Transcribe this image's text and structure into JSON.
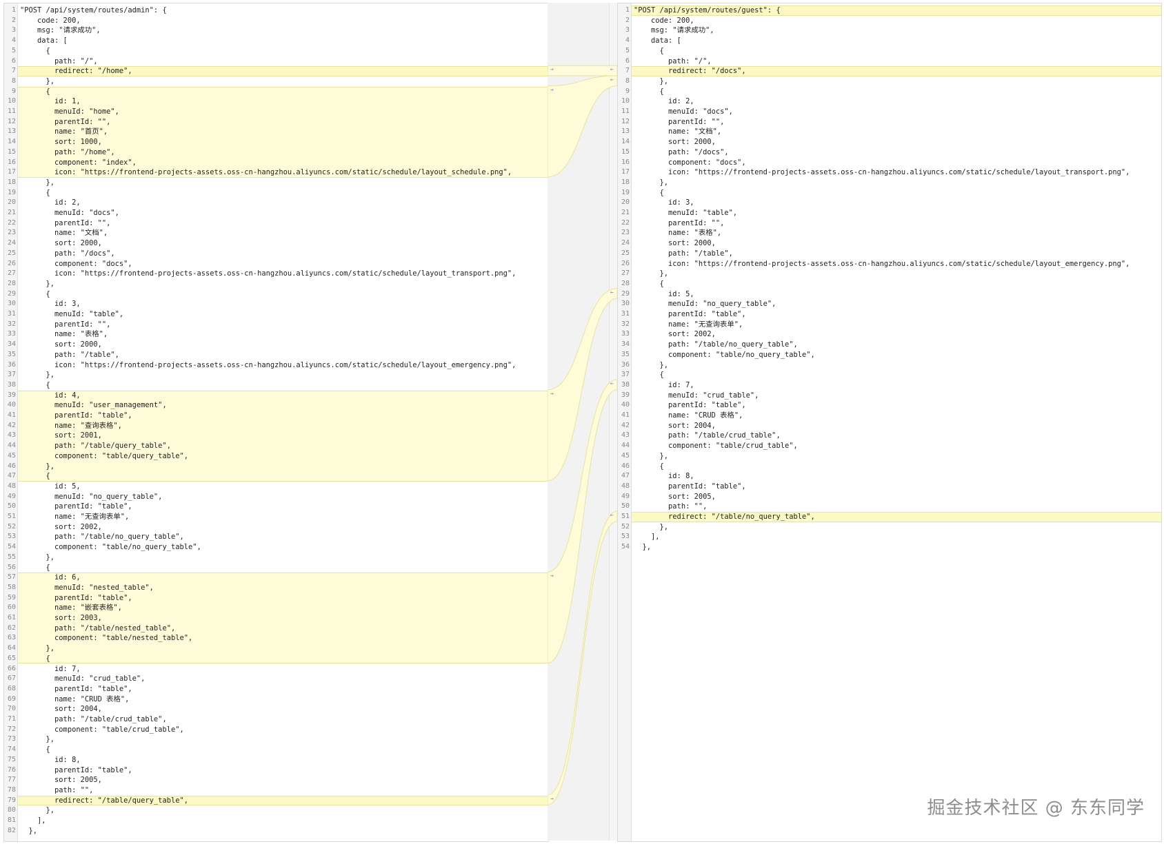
{
  "left": {
    "lines": [
      "\"POST /api/system/routes/admin\": {",
      "    code: 200,",
      "    msg: \"请求成功\",",
      "    data: [",
      "      {",
      "        path: \"/\",",
      "        redirect: \"/home\",",
      "      },",
      "      {",
      "        id: 1,",
      "        menuId: \"home\",",
      "        parentId: \"\",",
      "        name: \"首页\",",
      "        sort: 1000,",
      "        path: \"/home\",",
      "        component: \"index\",",
      "        icon: \"https://frontend-projects-assets.oss-cn-hangzhou.aliyuncs.com/static/schedule/layout_schedule.png\",",
      "      },",
      "      {",
      "        id: 2,",
      "        menuId: \"docs\",",
      "        parentId: \"\",",
      "        name: \"文档\",",
      "        sort: 2000,",
      "        path: \"/docs\",",
      "        component: \"docs\",",
      "        icon: \"https://frontend-projects-assets.oss-cn-hangzhou.aliyuncs.com/static/schedule/layout_transport.png\",",
      "      },",
      "      {",
      "        id: 3,",
      "        menuId: \"table\",",
      "        parentId: \"\",",
      "        name: \"表格\",",
      "        sort: 2000,",
      "        path: \"/table\",",
      "        icon: \"https://frontend-projects-assets.oss-cn-hangzhou.aliyuncs.com/static/schedule/layout_emergency.png\",",
      "      },",
      "      {",
      "        id: 4,",
      "        menuId: \"user_management\",",
      "        parentId: \"table\",",
      "        name: \"查询表格\",",
      "        sort: 2001,",
      "        path: \"/table/query_table\",",
      "        component: \"table/query_table\",",
      "      },",
      "      {",
      "        id: 5,",
      "        menuId: \"no_query_table\",",
      "        parentId: \"table\",",
      "        name: \"无查询表单\",",
      "        sort: 2002,",
      "        path: \"/table/no_query_table\",",
      "        component: \"table/no_query_table\",",
      "      },",
      "      {",
      "        id: 6,",
      "        menuId: \"nested_table\",",
      "        parentId: \"table\",",
      "        name: \"嵌套表格\",",
      "        sort: 2003,",
      "        path: \"/table/nested_table\",",
      "        component: \"table/nested_table\",",
      "      },",
      "      {",
      "        id: 7,",
      "        menuId: \"crud_table\",",
      "        parentId: \"table\",",
      "        name: \"CRUD 表格\",",
      "        sort: 2004,",
      "        path: \"/table/crud_table\",",
      "        component: \"table/crud_table\",",
      "      },",
      "      {",
      "        id: 8,",
      "        parentId: \"table\",",
      "        sort: 2005,",
      "        path: \"\",",
      "        redirect: \"/table/query_table\",",
      "      },",
      "    ],",
      "  },"
    ],
    "highlights": [
      [
        7,
        7
      ],
      [
        9,
        17
      ],
      [
        39,
        47
      ],
      [
        57,
        65
      ],
      [
        79,
        79
      ]
    ]
  },
  "right": {
    "lines": [
      "\"POST /api/system/routes/guest\": {",
      "    code: 200,",
      "    msg: \"请求成功\",",
      "    data: [",
      "      {",
      "        path: \"/\",",
      "        redirect: \"/docs\",",
      "      },",
      "      {",
      "        id: 2,",
      "        menuId: \"docs\",",
      "        parentId: \"\",",
      "        name: \"文档\",",
      "        sort: 2000,",
      "        path: \"/docs\",",
      "        component: \"docs\",",
      "        icon: \"https://frontend-projects-assets.oss-cn-hangzhou.aliyuncs.com/static/schedule/layout_transport.png\",",
      "      },",
      "      {",
      "        id: 3,",
      "        menuId: \"table\",",
      "        parentId: \"\",",
      "        name: \"表格\",",
      "        sort: 2000,",
      "        path: \"/table\",",
      "        icon: \"https://frontend-projects-assets.oss-cn-hangzhou.aliyuncs.com/static/schedule/layout_emergency.png\",",
      "      },",
      "      {",
      "        id: 5,",
      "        menuId: \"no_query_table\",",
      "        parentId: \"table\",",
      "        name: \"无查询表单\",",
      "        sort: 2002,",
      "        path: \"/table/no_query_table\",",
      "        component: \"table/no_query_table\",",
      "      },",
      "      {",
      "        id: 7,",
      "        menuId: \"crud_table\",",
      "        parentId: \"table\",",
      "        name: \"CRUD 表格\",",
      "        sort: 2004,",
      "        path: \"/table/crud_table\",",
      "        component: \"table/crud_table\",",
      "      },",
      "      {",
      "        id: 8,",
      "        parentId: \"table\",",
      "        sort: 2005,",
      "        path: \"\",",
      "        redirect: \"/table/no_query_table\",",
      "      },",
      "    ],",
      "  },"
    ],
    "highlights": [
      [
        1,
        1
      ],
      [
        7,
        7
      ],
      [
        51,
        51
      ]
    ]
  },
  "watermark": "掘金技术社区 @ 东东同学",
  "colors": {
    "highlight": "#fefcd8",
    "highlight_border": "#e9e29a",
    "arrow": "#6b6bd6",
    "line_number": "#888888"
  }
}
